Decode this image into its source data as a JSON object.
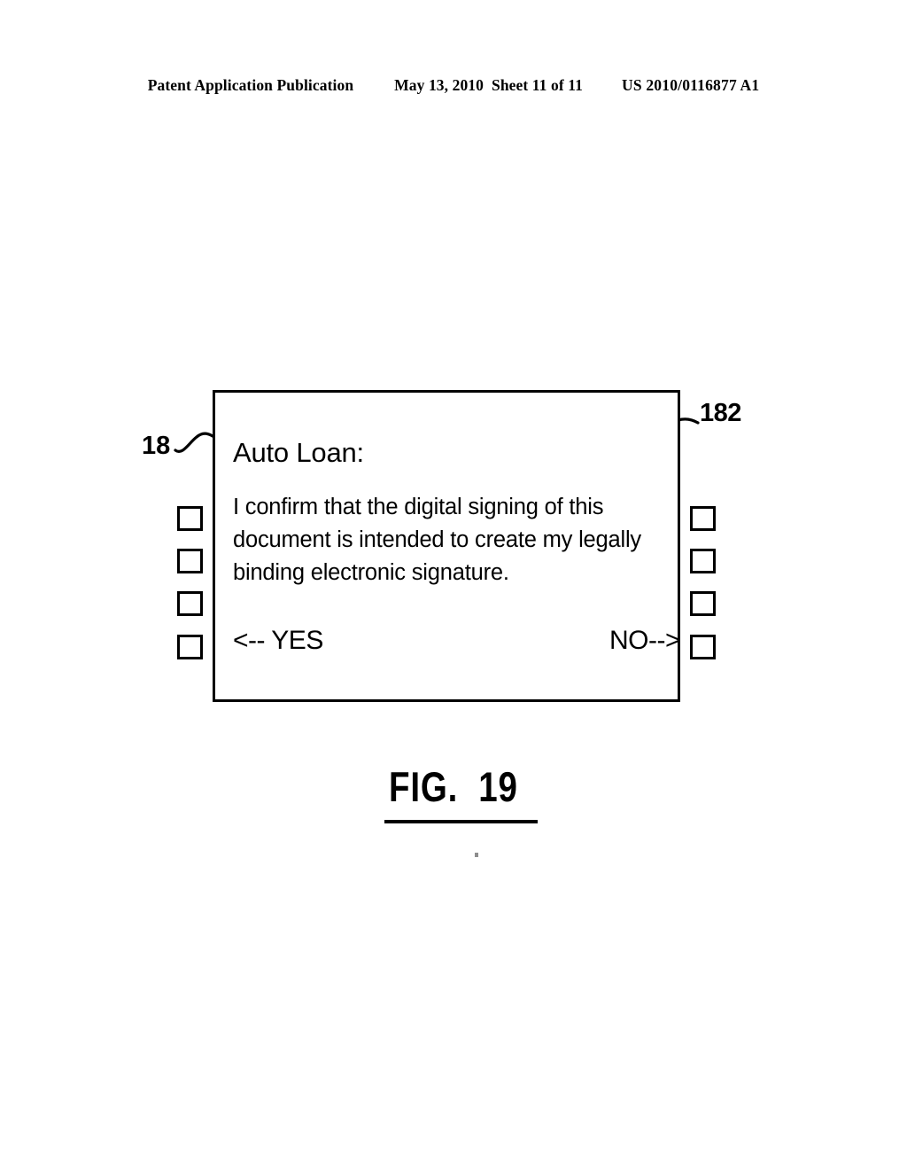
{
  "header": {
    "publication": "Patent Application Publication",
    "date": "May 13, 2010",
    "sheet": "Sheet 11 of 11",
    "patent_number": "US 2010/0116877 A1"
  },
  "figure": {
    "caption": "FIG.  19",
    "reference_numerals": {
      "device": "18",
      "screen": "182"
    }
  },
  "device": {
    "screen": {
      "title": "Auto Loan:",
      "body": "I confirm that the digital signing of this document is intended to create my legally binding electronic signature.",
      "actions": {
        "yes": "<-- YES",
        "no": "NO-->"
      }
    },
    "left_buttons": [
      {
        "label": ""
      },
      {
        "label": ""
      },
      {
        "label": ""
      },
      {
        "label": ""
      }
    ],
    "right_buttons": [
      {
        "label": ""
      },
      {
        "label": ""
      },
      {
        "label": ""
      },
      {
        "label": ""
      }
    ]
  },
  "colors": {
    "ink": "#000000",
    "paper": "#ffffff"
  }
}
